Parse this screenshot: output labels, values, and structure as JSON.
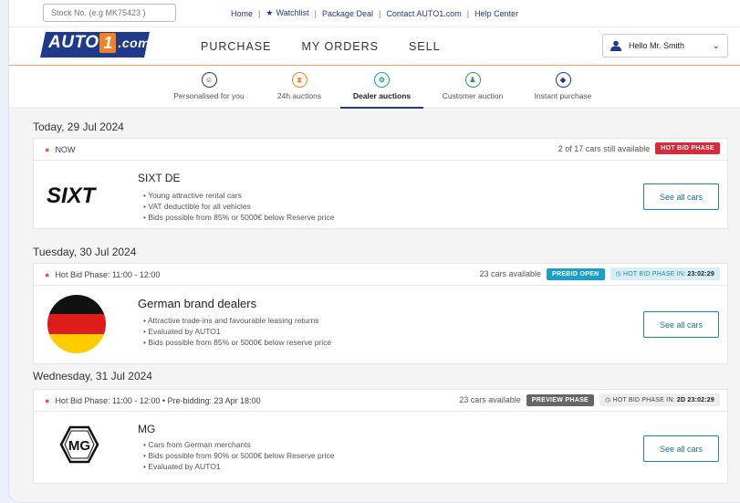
{
  "topbar": {
    "stock_placeholder": "Stock No. (e.g MK75423 )",
    "links": [
      "Home",
      "Watchlist",
      "Package Deal",
      "Contact AUTO1.com",
      "Help Center"
    ]
  },
  "header": {
    "logo_pre": "AUTO",
    "logo_num": "1",
    "logo_post": ".com",
    "nav": [
      "PURCHASE",
      "MY ORDERS",
      "SELL"
    ],
    "user_label": "Hello Mr. Smith"
  },
  "tabs": [
    {
      "label": "Personalised for you",
      "icon": "person-icon",
      "color": "#1e3a8a"
    },
    {
      "label": "24h auctions",
      "icon": "hourglass-icon",
      "color": "#f58220"
    },
    {
      "label": "Dealer auctions",
      "icon": "dealer-icon",
      "color": "#1aa0a0"
    },
    {
      "label": "Customer auction",
      "icon": "customer-icon",
      "color": "#2a9d5c"
    },
    {
      "label": "Instant purchase",
      "icon": "tag-icon",
      "color": "#1e3a8a"
    }
  ],
  "days": [
    {
      "date": "Today, 29 Jul 2024",
      "phase": "NOW",
      "availability": "2 of 17 cars still available",
      "badge": "HOT BID PHASE",
      "seller": "SIXT DE",
      "logo_text": "SIXT",
      "features": [
        "Young attractive rental cars",
        "VAT deductible for all vehicles",
        "Bids possible from 85% or 5000€ below Reserve price"
      ],
      "button": "See all cars"
    },
    {
      "date": "Tuesday, 30 Jul 2024",
      "phase": "Hot Bid Phase: 11:00 - 12:00",
      "availability": "23 cars available",
      "badge": "PREBID OPEN",
      "timer_label": "HOT BID PHASE IN:",
      "timer_value": "23:02:29",
      "seller": "German brand dealers",
      "features": [
        "Attractive trade-ins and favourable leasing returns",
        "Evaluated by AUTO1",
        "Bids possible from 85% or 5000€ below reserve price"
      ],
      "button": "See all cars"
    },
    {
      "date": "Wednesday, 31 Jul 2024",
      "phase": "Hot Bid Phase: 11:00 - 12:00 • Pre-bidding: 23 Apr 18:00",
      "availability": "23 cars available",
      "badge": "PREVIEW PHASE",
      "timer_label": "HOT BID PHASE IN:",
      "timer_value": "2D 23:02:29",
      "seller": "MG",
      "logo_text": "MG",
      "features": [
        "Cars from German merchants",
        "Bids possible from 90% or 5000€ below Reserve price",
        "Evaluated by AUTO1"
      ],
      "button": "See all cars"
    }
  ],
  "colors": {
    "brand_blue": "#1e3a8a",
    "brand_orange": "#f58220",
    "hot_red": "#d92c3b",
    "prebid_blue": "#1aa0c8"
  }
}
